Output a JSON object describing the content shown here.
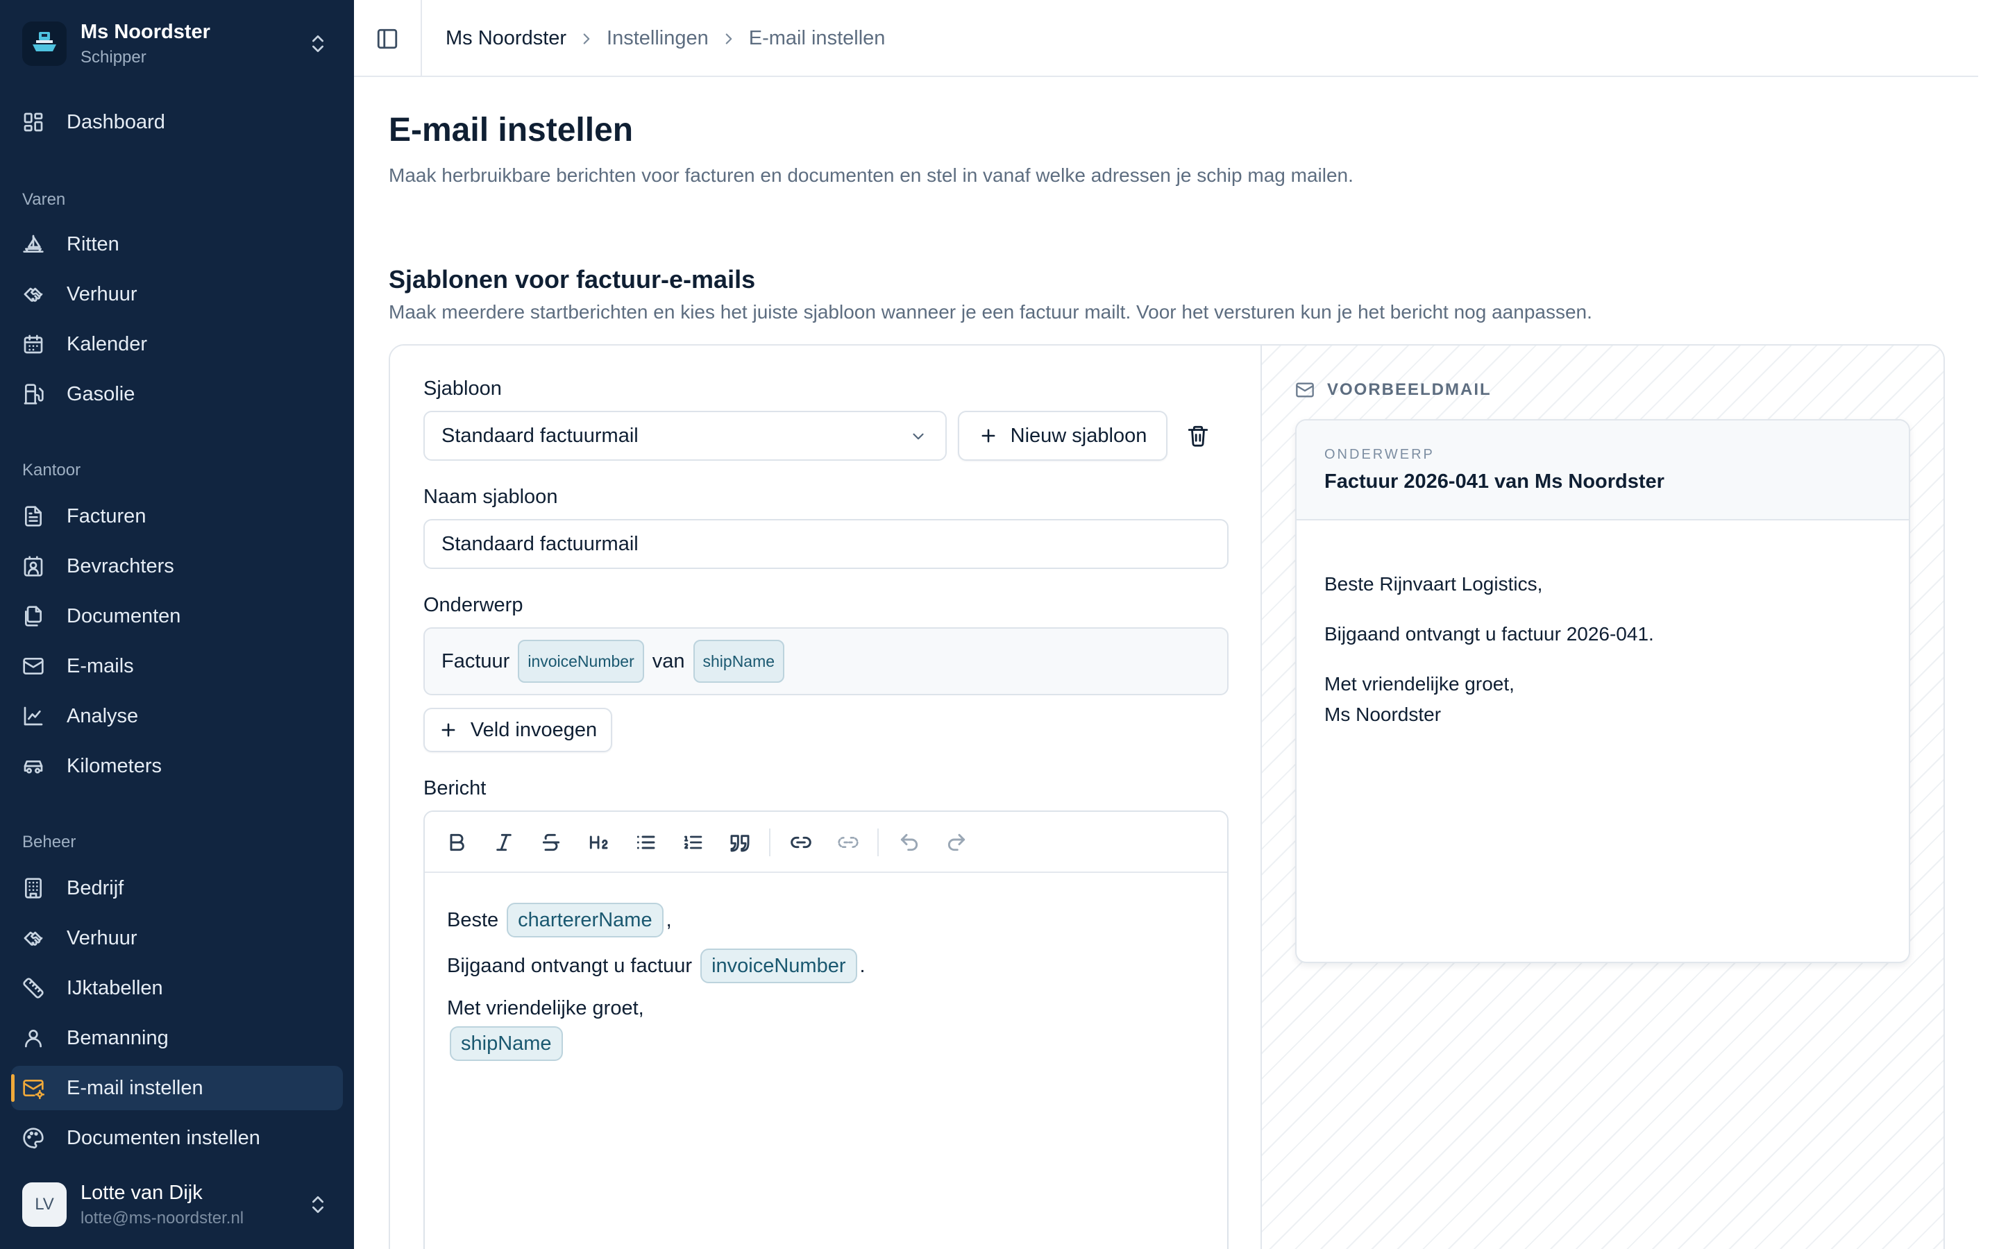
{
  "ship": {
    "name": "Ms Noordster",
    "role": "Schipper"
  },
  "nav": {
    "dashboard": "Dashboard",
    "sections": {
      "varen": "Varen",
      "kantoor": "Kantoor",
      "beheer": "Beheer"
    },
    "varen": [
      "Ritten",
      "Verhuur",
      "Kalender",
      "Gasolie"
    ],
    "kantoor": [
      "Facturen",
      "Bevrachters",
      "Documenten",
      "E-mails",
      "Analyse",
      "Kilometers"
    ],
    "beheer": [
      "Bedrijf",
      "Verhuur",
      "IJktabellen",
      "Bemanning",
      "E-mail instellen",
      "Documenten instellen"
    ],
    "active": "E-mail instellen"
  },
  "user": {
    "initials": "LV",
    "name": "Lotte van Dijk",
    "email": "lotte@ms-noordster.nl"
  },
  "breadcrumb": [
    "Ms Noordster",
    "Instellingen",
    "E-mail instellen"
  ],
  "page": {
    "title": "E-mail instellen",
    "description": "Maak herbruikbare berichten voor facturen en documenten en stel in vanaf welke adressen je schip mag mailen."
  },
  "templates_section": {
    "title": "Sjablonen voor factuur-e-mails",
    "description": "Maak meerdere startberichten en kies het juiste sjabloon wanneer je een factuur mailt. Voor het versturen kun je het bericht nog aanpassen."
  },
  "form": {
    "template_label": "Sjabloon",
    "template_selected": "Standaard factuurmail",
    "new_template_button": "Nieuw sjabloon",
    "name_label": "Naam sjabloon",
    "name_value": "Standaard factuurmail",
    "subject_label": "Onderwerp",
    "subject": {
      "part1": "Factuur",
      "field1": "invoiceNumber",
      "part2": "van",
      "field2": "shipName"
    },
    "insert_field_button": "Veld invoegen",
    "message_label": "Bericht",
    "message": {
      "greeting": "Beste",
      "field_charterer": "chartererName",
      "after_charterer": ",",
      "line2": "Bijgaand ontvangt u factuur",
      "field_invoice": "invoiceNumber",
      "after_invoice": ".",
      "closing": "Met vriendelijke groet,",
      "field_ship": "shipName"
    }
  },
  "toolbar_icons": [
    "bold-icon",
    "italic-icon",
    "strikethrough-icon",
    "heading-2-icon",
    "bullet-list-icon",
    "ordered-list-icon",
    "quote-icon",
    "link-icon",
    "unlink-icon",
    "undo-icon",
    "redo-icon"
  ],
  "preview": {
    "header": "VOORBEELDMAIL",
    "subject_label": "ONDERWERP",
    "subject": "Factuur 2026-041 van Ms Noordster",
    "body": {
      "greeting": "Beste Rijnvaart Logistics,",
      "line2": "Bijgaand ontvangt u factuur 2026-041.",
      "closing": "Met vriendelijke groet,",
      "signature": "Ms Noordster"
    }
  },
  "colors": {
    "sidebar": "#112540",
    "accent": "#f0a93a",
    "chip_bg": "#e2eef3",
    "chip_text": "#1a5870"
  }
}
